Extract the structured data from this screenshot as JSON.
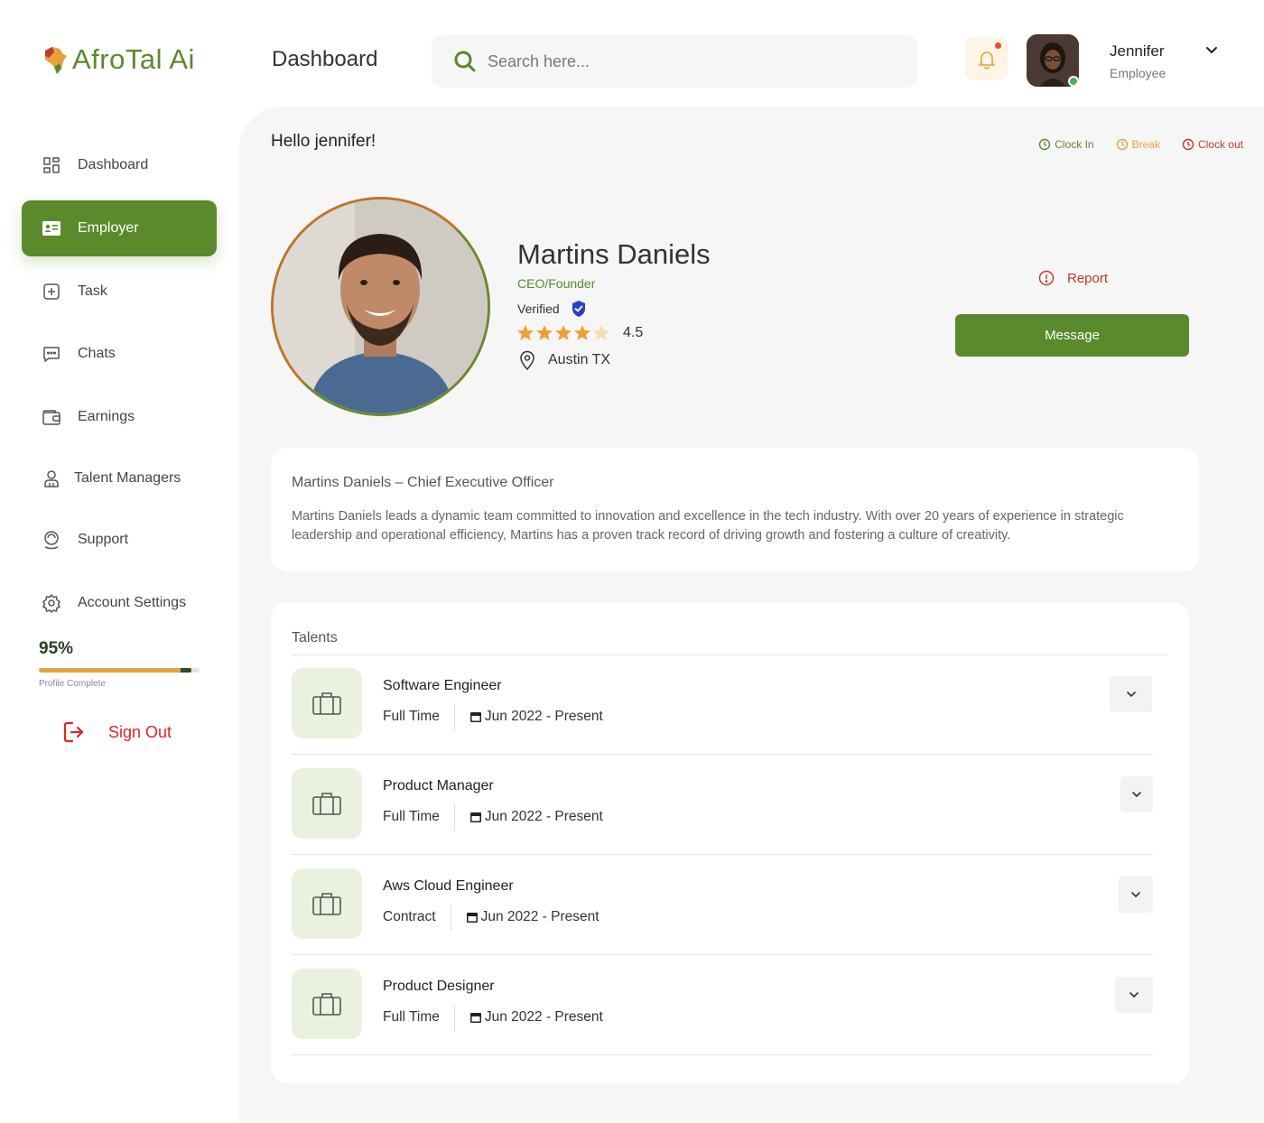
{
  "brand": {
    "name": "AfroTal Ai",
    "color": "#5a8a2b"
  },
  "header": {
    "title": "Dashboard",
    "search_placeholder": "Search here...",
    "user": {
      "name": "Jennifer",
      "role": "Employee"
    }
  },
  "sidebar": {
    "items": [
      {
        "label": "Dashboard",
        "icon": "grid-icon"
      },
      {
        "label": "Employer",
        "icon": "id-card-icon",
        "active": true
      },
      {
        "label": "Task",
        "icon": "plus-square-icon"
      },
      {
        "label": "Chats",
        "icon": "chat-icon"
      },
      {
        "label": "Earnings",
        "icon": "wallet-icon"
      },
      {
        "label": "Talent Managers",
        "icon": "user-icon"
      },
      {
        "label": "Support",
        "icon": "headset-icon"
      },
      {
        "label": "Account Settings",
        "icon": "gear-icon"
      }
    ],
    "profile": {
      "percent_label": "95%",
      "percent": 95,
      "label": "Profile Complete"
    },
    "signout_label": "Sign Out"
  },
  "main": {
    "greeting": "Hello jennifer!",
    "clock": {
      "in": "Clock In",
      "break": "Break",
      "out": "Clock out"
    },
    "profile": {
      "name": "Martins Daniels",
      "role": "CEO/Founder",
      "verified": "Verified",
      "rating": 4.5,
      "rating_label": "4.5",
      "location": "Austin TX",
      "report_label": "Report",
      "message_label": "Message"
    },
    "bio": {
      "title": "Martins Daniels – Chief Executive Officer",
      "text": "Martins Daniels leads a dynamic team committed to innovation and excellence in the tech industry. With over 20 years of experience in strategic leadership and operational efficiency, Martins has a proven track record of driving growth and fostering a culture of creativity."
    },
    "talents": {
      "title": "Talents",
      "items": [
        {
          "title": "Software Engineer",
          "type": "Full Time",
          "date": "Jun 2022 - Present"
        },
        {
          "title": "Product Manager",
          "type": "Full Time",
          "date": "Jun 2022 - Present"
        },
        {
          "title": "Aws Cloud Engineer",
          "type": "Contract",
          "date": "Jun 2022 - Present"
        },
        {
          "title": "Product Designer",
          "type": "Full Time",
          "date": "Jun 2022 - Present"
        }
      ]
    }
  }
}
